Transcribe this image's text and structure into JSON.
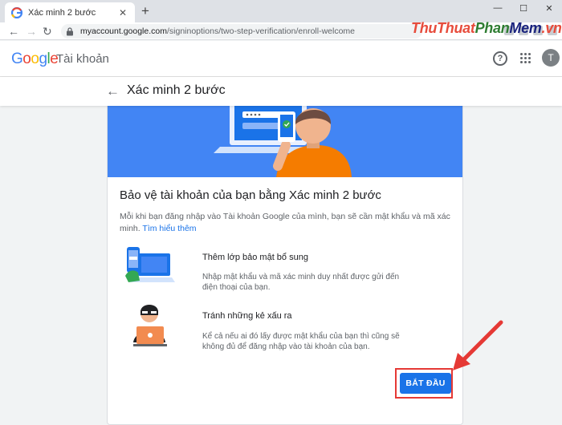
{
  "browser": {
    "tab_title": "Xác minh 2 bước",
    "tab_close": "✕",
    "new_tab": "+",
    "window_controls": [
      "—",
      "☐",
      "✕"
    ],
    "back": "←",
    "forward": "→",
    "reload": "↻",
    "url_domain": "myaccount.google.com",
    "url_path": "/signinoptions/two-step-verification/enroll-welcome"
  },
  "watermark": {
    "part1": "ThuThuat",
    "part2": "Phan",
    "part3": "Mem",
    "part4": ".vn"
  },
  "header": {
    "logo": {
      "g1": "G",
      "o1": "o",
      "o2": "o",
      "g2": "g",
      "l": "l",
      "e": "e"
    },
    "product": "Tài khoản",
    "help": "?",
    "avatar_initial": "T"
  },
  "page": {
    "back": "←",
    "title": "Xác minh 2 bước"
  },
  "card": {
    "heading": "Bảo vệ tài khoản của bạn bằng Xác minh 2 bước",
    "description": "Mỗi khi bạn đăng nhập vào Tài khoản Google của mình, bạn sẽ cần mật khẩu và mã xác minh.",
    "learn_more": "Tìm hiểu thêm",
    "features": [
      {
        "title": "Thêm lớp bảo mật bổ sung",
        "description": "Nhập mật khẩu và mã xác minh duy nhất được gửi đến điện thoại của bạn."
      },
      {
        "title": "Tránh những kẻ xấu ra",
        "description": "Kể cả nếu ai đó lấy được mật khẩu của bạn thì cũng sẽ không đủ để đăng nhập vào tài khoản của bạn."
      }
    ],
    "start_button": "BẮT ĐẦU"
  },
  "colors": {
    "accent": "#1a73e8",
    "hero_background": "#4285f4",
    "annotation": "#e53935"
  }
}
